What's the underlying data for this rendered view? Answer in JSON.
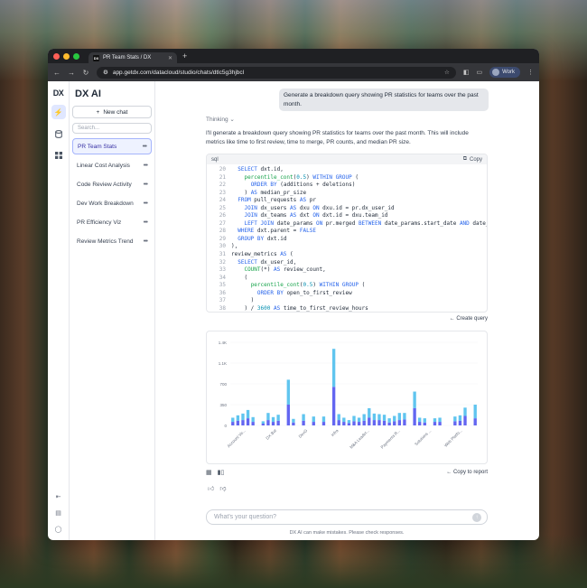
{
  "browser": {
    "tab_title": "PR Team Stats / DX",
    "tab_favicon": "DX",
    "new_tab": "+",
    "url": "app.getdx.com/datacloud/studio/chats/dtlc5g3hjbcl",
    "profile_label": "Work"
  },
  "rail": {
    "logo": "DX",
    "icons": [
      "lightning-icon",
      "database-icon",
      "grid-icon"
    ],
    "bottom_icons": [
      "collapse-icon",
      "document-icon",
      "chat-bubble-icon"
    ]
  },
  "sidebar": {
    "title": "DX AI",
    "new_chat_label": "New chat",
    "search_placeholder": "Search...",
    "chats": [
      {
        "label": "PR Team Stats",
        "active": true
      },
      {
        "label": "Linear Cost Analysis",
        "active": false
      },
      {
        "label": "Code Review Activity",
        "active": false
      },
      {
        "label": "Dev Work Breakdown",
        "active": false
      },
      {
        "label": "PR Efficiency Viz",
        "active": false
      },
      {
        "label": "Review Metrics Trend",
        "active": false
      }
    ]
  },
  "conversation": {
    "user_message": "Generate a breakdown query showing PR statistics for teams over the past month.",
    "thinking_label": "Thinking",
    "assistant_text": "I'll generate a breakdown query showing PR statistics for teams over the past month. This will include metrics like time to first review, time to merge, PR counts, and median PR size.",
    "code": {
      "language": "sql",
      "copy_label": "Copy",
      "lines": [
        {
          "n": "20",
          "t": "  SELECT dxt.id,"
        },
        {
          "n": "21",
          "t": "    percentile_cont(0.5) WITHIN GROUP ("
        },
        {
          "n": "22",
          "t": "      ORDER BY (additions + deletions)"
        },
        {
          "n": "23",
          "t": "    ) AS median_pr_size"
        },
        {
          "n": "24",
          "t": "  FROM pull_requests AS pr"
        },
        {
          "n": "25",
          "t": "    JOIN dx_users AS dxu ON dxu.id = pr.dx_user_id"
        },
        {
          "n": "26",
          "t": "    JOIN dx_teams AS dxt ON dxt.id = dxu.team_id"
        },
        {
          "n": "27",
          "t": "    LEFT JOIN date_params ON pr.merged BETWEEN date_params.start_date AND date_p"
        },
        {
          "n": "28",
          "t": "  WHERE dxt.parent = FALSE"
        },
        {
          "n": "29",
          "t": "  GROUP BY dxt.id"
        },
        {
          "n": "30",
          "t": "),"
        },
        {
          "n": "31",
          "t": "review_metrics AS ("
        },
        {
          "n": "32",
          "t": "  SELECT dx_user_id,"
        },
        {
          "n": "33",
          "t": "    COUNT(*) AS review_count,"
        },
        {
          "n": "34",
          "t": "    ("
        },
        {
          "n": "35",
          "t": "      percentile_cont(0.5) WITHIN GROUP ("
        },
        {
          "n": "36",
          "t": "        ORDER BY open_to_first_review"
        },
        {
          "n": "37",
          "t": "      )"
        },
        {
          "n": "38",
          "t": "    ) / 3600 AS time_to_first_review_hours"
        }
      ]
    },
    "create_query_label": "Create query",
    "copy_to_report_label": "Copy to report",
    "ask_placeholder": "What's your question?",
    "disclaimer": "DX AI can make mistakes. Please check responses."
  },
  "chart_data": {
    "type": "bar",
    "stacked": true,
    "yticks": [
      "1.4K",
      "1.1K",
      "700",
      "350",
      "0"
    ],
    "ylim": [
      0,
      1400
    ],
    "category_labels": [
      "Account Ve...",
      "DX Bot",
      "DevG",
      "Infra",
      "M&A Leader...",
      "Payments R...",
      "Solutions ...",
      "Web Platfo..."
    ],
    "series": [
      {
        "color": "#6366f1",
        "values": [
          60,
          80,
          90,
          120,
          60,
          0,
          30,
          90,
          60,
          80,
          0,
          350,
          50,
          0,
          80,
          0,
          60,
          0,
          60,
          0,
          650,
          90,
          60,
          40,
          70,
          60,
          80,
          130,
          90,
          90,
          80,
          50,
          70,
          90,
          100,
          0,
          290,
          60,
          50,
          0,
          60,
          60,
          0,
          0,
          70,
          80,
          160,
          0,
          120
        ]
      },
      {
        "color": "#60c5ef",
        "values": [
          70,
          90,
          110,
          140,
          80,
          0,
          40,
          120,
          80,
          100,
          0,
          420,
          60,
          0,
          110,
          0,
          90,
          0,
          90,
          0,
          640,
          100,
          70,
          50,
          90,
          70,
          110,
          160,
          110,
          100,
          100,
          70,
          90,
          120,
          110,
          0,
          280,
          70,
          70,
          0,
          60,
          70,
          0,
          0,
          80,
          90,
          140,
          0,
          230
        ]
      }
    ]
  },
  "colors": {
    "accent": "#4f46e5",
    "active_bg": "#eef2ff"
  }
}
